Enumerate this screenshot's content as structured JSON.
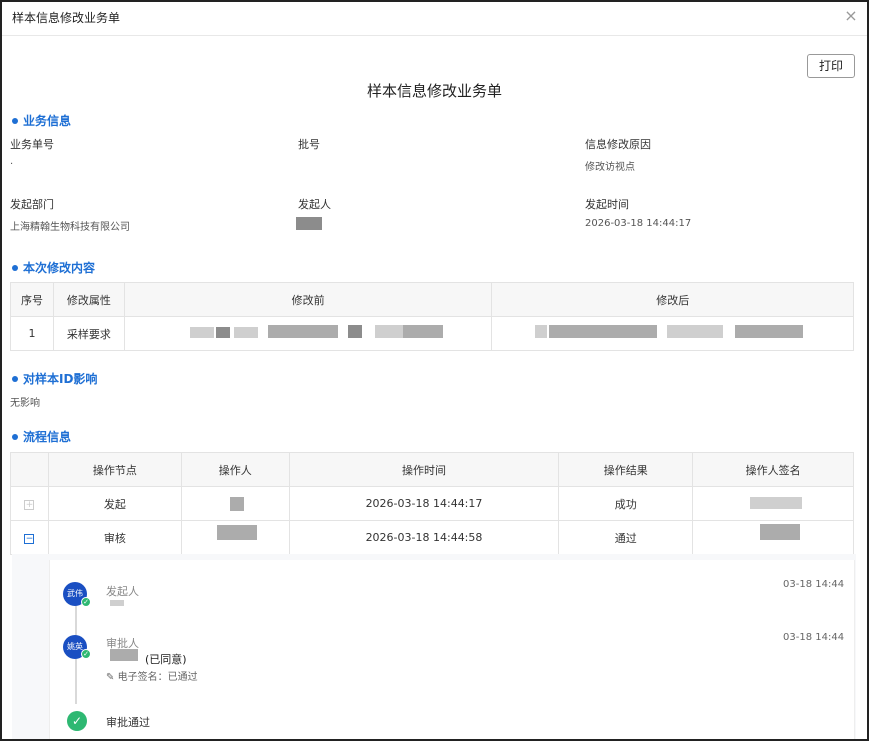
{
  "dialog": {
    "title": "样本信息修改业务单",
    "close_icon": "×"
  },
  "print_label": "打印",
  "form_title": "样本信息修改业务单",
  "sections": {
    "business": "业务信息",
    "changes": "本次修改内容",
    "impact": "对样本ID影响",
    "flow": "流程信息"
  },
  "business": {
    "order_no_label": "业务单号",
    "order_no_value": ".",
    "batch_label": "批号",
    "reason_label": "信息修改原因",
    "reason_value": "修改访视点",
    "dept_label": "发起部门",
    "dept_value": "上海精翰生物科技有限公司",
    "initiator_label": "发起人",
    "time_label": "发起时间",
    "time_value": "2026-03-18 14:44:17"
  },
  "changes_table": {
    "headers": [
      "序号",
      "修改属性",
      "修改前",
      "修改后"
    ],
    "rows": [
      {
        "index": "1",
        "attribute": "采样要求"
      }
    ]
  },
  "impact_value": "无影响",
  "flow_table": {
    "headers": [
      "操作节点",
      "操作人",
      "操作时间",
      "操作结果",
      "操作人签名"
    ],
    "rows": [
      {
        "expand": "+",
        "node": "发起",
        "time": "2026-03-18 14:44:17",
        "result": "成功"
      },
      {
        "expand": "−",
        "node": "审核",
        "time": "2026-03-18 14:44:58",
        "result": "通过"
      }
    ]
  },
  "timeline": {
    "item1": {
      "avatar": "武伟",
      "role": "发起人",
      "time": "03-18 14:44"
    },
    "item2": {
      "avatar": "姚英",
      "role": "审批人",
      "status": "(已同意)",
      "sign_label": "电子签名：已通过",
      "time": "03-18 14:44"
    },
    "final": {
      "label": "审批通过",
      "icon": "✓"
    }
  },
  "colors": {
    "accent": "#1e6fd4",
    "success": "#2eb872",
    "avatar": "#1a4fc2"
  },
  "icons": {
    "close": "close-icon",
    "pen": "pen-icon",
    "check": "check-icon"
  }
}
